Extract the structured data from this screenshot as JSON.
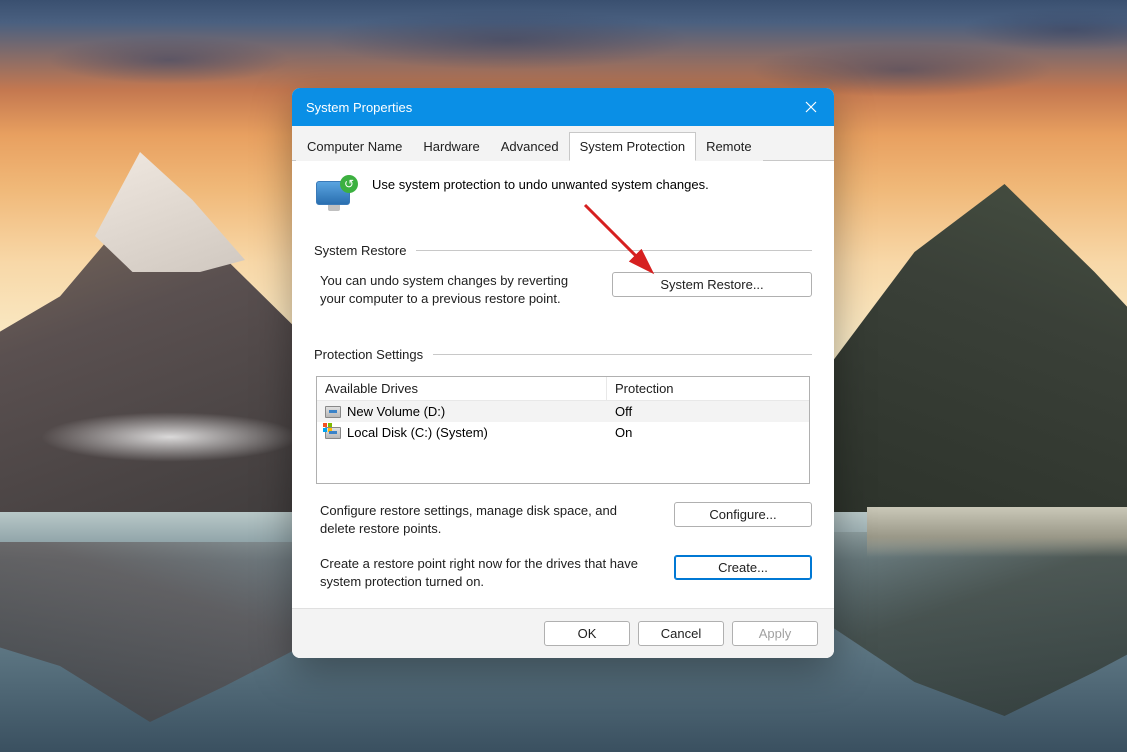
{
  "dialog": {
    "title": "System Properties",
    "tabs": [
      {
        "label": "Computer Name"
      },
      {
        "label": "Hardware"
      },
      {
        "label": "Advanced"
      },
      {
        "label": "System Protection"
      },
      {
        "label": "Remote"
      }
    ],
    "active_tab": "System Protection",
    "intro_text": "Use system protection to undo unwanted system changes.",
    "restore": {
      "heading": "System Restore",
      "description": "You can undo system changes by reverting your computer to a previous restore point.",
      "button": "System Restore..."
    },
    "protection": {
      "heading": "Protection Settings",
      "columns": {
        "drive": "Available Drives",
        "protection": "Protection"
      },
      "drives": [
        {
          "name": "New Volume (D:)",
          "protection": "Off",
          "system": false
        },
        {
          "name": "Local Disk (C:) (System)",
          "protection": "On",
          "system": true
        }
      ],
      "configure_text": "Configure restore settings, manage disk space, and delete restore points.",
      "configure_button": "Configure...",
      "create_text": "Create a restore point right now for the drives that have system protection turned on.",
      "create_button": "Create..."
    },
    "buttons": {
      "ok": "OK",
      "cancel": "Cancel",
      "apply": "Apply"
    }
  }
}
